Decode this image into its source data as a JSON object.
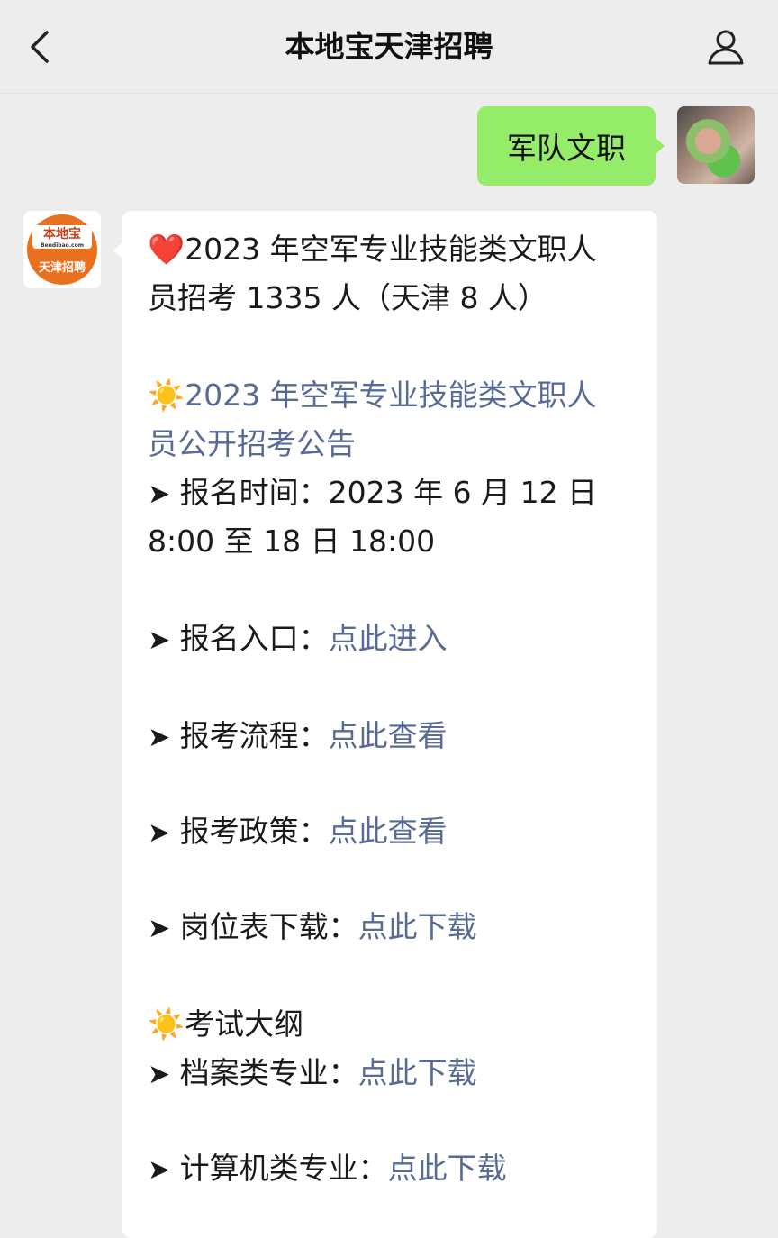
{
  "header": {
    "title": "本地宝天津招聘"
  },
  "outgoing": {
    "text": "军队文职"
  },
  "bot_logo": {
    "top_text": "本地宝",
    "sub_text": "Bendibao.com",
    "bottom_text": "天津招聘"
  },
  "message": {
    "heart": "❤️",
    "sun": "☀️",
    "arrow": "➤",
    "title_line1": "2023 年空军专业技能类文职人",
    "title_line2": "员招考 1335 人（天津 8 人）",
    "announce_line1": "2023 年空军专业技能类文职人",
    "announce_line2": "员公开招考公告",
    "reg_time_line1": " 报名时间：2023 年 6 月 12 日",
    "reg_time_line2": "8:00 至 18 日 18:00",
    "items": [
      {
        "label": " 报名入口：",
        "link": "点此进入"
      },
      {
        "label": " 报考流程：",
        "link": "点此查看"
      },
      {
        "label": " 报考政策：",
        "link": "点此查看"
      },
      {
        "label": " 岗位表下载：",
        "link": "点此下载"
      }
    ],
    "outline_title": "考试大纲",
    "outline_items": [
      {
        "label": " 档案类专业：",
        "link": "点此下载"
      },
      {
        "label": " 计算机类专业：",
        "link": "点此下载"
      }
    ]
  }
}
